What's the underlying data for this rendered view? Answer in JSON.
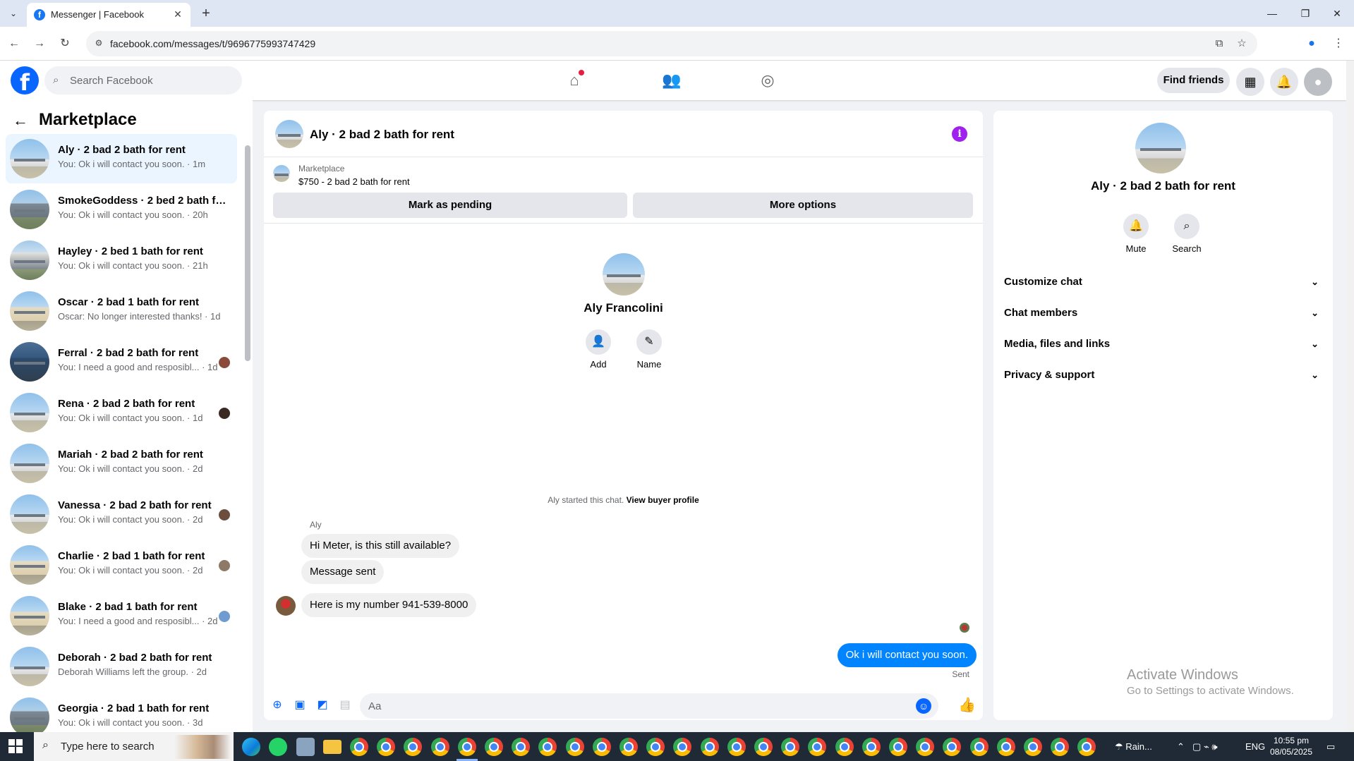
{
  "browser": {
    "tab_title": "Messenger | Facebook",
    "url": "facebook.com/messages/t/9696775993747429"
  },
  "header": {
    "search_placeholder": "Search Facebook",
    "find_friends": "Find friends"
  },
  "sidebar": {
    "title": "Marketplace",
    "conversations": [
      {
        "title": "Aly · 2 bad 2 bath for rent",
        "preview": "You: Ok i will contact you soon. · 1m",
        "thumb": "house",
        "avatar": ""
      },
      {
        "title": "SmokeGoddess · 2 bed 2 bath fo...",
        "preview": "You: Ok i will contact you soon. · 20h",
        "thumb": "grey",
        "avatar": ""
      },
      {
        "title": "Hayley · 2 bed 1 bath for rent",
        "preview": "You: Ok i will contact you soon. · 21h",
        "thumb": "porch",
        "avatar": ""
      },
      {
        "title": "Oscar · 2 bad 1 bath for rent",
        "preview": "Oscar: No longer interested thanks! · 1d",
        "thumb": "tan",
        "avatar": ""
      },
      {
        "title": "Ferral · 2 bad 2 bath for rent",
        "preview": "You: I need a good and resposibl... · 1d",
        "thumb": "blue",
        "avatar": "#8a4b3a"
      },
      {
        "title": "Rena · 2 bad 2 bath for rent",
        "preview": "You: Ok i will contact you soon. · 1d",
        "thumb": "house",
        "avatar": "#3b2a22"
      },
      {
        "title": "Mariah · 2 bad 2 bath for rent",
        "preview": "You: Ok i will contact you soon. · 2d",
        "thumb": "house",
        "avatar": ""
      },
      {
        "title": "Vanessa · 2 bad 2 bath for rent",
        "preview": "You: Ok i will contact you soon. · 2d",
        "thumb": "house",
        "avatar": "#6b4e3d"
      },
      {
        "title": "Charlie · 2 bad 1 bath for rent",
        "preview": "You: Ok i will contact you soon. · 2d",
        "thumb": "tan",
        "avatar": "#8d7a66"
      },
      {
        "title": "Blake · 2 bad 1 bath for rent",
        "preview": "You: I need a good and resposibl... · 2d",
        "thumb": "tan",
        "avatar": "#6f9bd1"
      },
      {
        "title": "Deborah · 2 bad 2 bath for rent",
        "preview": "Deborah Williams left the group. · 2d",
        "thumb": "house",
        "avatar": ""
      },
      {
        "title": "Georgia · 2 bad 1 bath for rent",
        "preview": "You: Ok i will contact you soon. · 3d",
        "thumb": "grey",
        "avatar": ""
      }
    ]
  },
  "chat": {
    "title": "Aly · 2 bad 2 bath for rent",
    "marketplace_label": "Marketplace",
    "listing": "$750 - 2 bad 2 bath for rent",
    "mark_pending": "Mark as pending",
    "more_options": "More options",
    "profile_name": "Aly Francolini",
    "add_label": "Add",
    "name_label": "Name",
    "started_text": "Aly started this chat.",
    "view_profile": "View buyer profile",
    "sender": "Aly",
    "messages": [
      "Hi Meter, is this still available?",
      "Message sent",
      "Here is my number 941-539-8000"
    ],
    "my_message": "Ok i will contact you soon.",
    "sent_label": "Sent",
    "composer_placeholder": "Aa"
  },
  "panel": {
    "name": "Aly · 2 bad 2 bath for rent",
    "mute": "Mute",
    "search": "Search",
    "rows": [
      "Customize chat",
      "Chat members",
      "Media, files and links",
      "Privacy & support"
    ]
  },
  "watermark": {
    "line1": "Activate Windows",
    "line2": "Go to Settings to activate Windows."
  },
  "taskbar": {
    "search_placeholder": "Type here to search",
    "weather": "Rain...",
    "lang": "ENG",
    "time": "10:55 pm",
    "date": "08/05/2025"
  },
  "colors": {
    "brand": "#0866ff",
    "sent_bubble": "#0084ff",
    "info": "#a020f0",
    "active_row": "#ebf5ff"
  }
}
